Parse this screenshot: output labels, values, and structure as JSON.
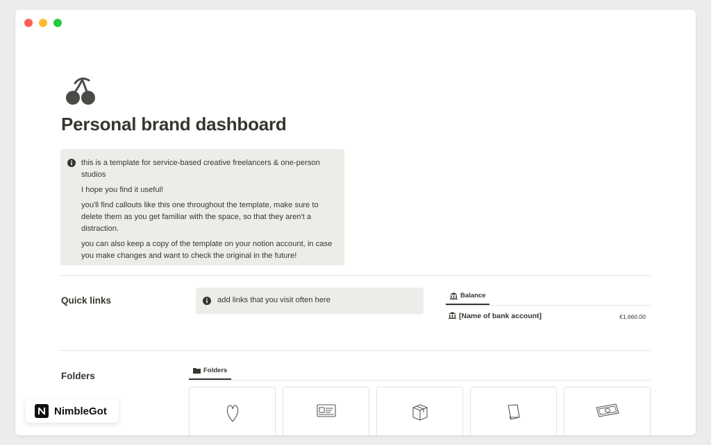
{
  "window": {
    "controls": [
      "close",
      "minimize",
      "maximize"
    ]
  },
  "page": {
    "icon": "cherry-icon",
    "title": "Personal brand dashboard"
  },
  "intro_callout": {
    "icon": "info-icon",
    "paragraphs": [
      "this is a template for service-based creative freelancers & one-person studios",
      "I hope you find it useful!",
      "you'll find callouts like this one throughout the template, make sure to delete them as you get familiar with the space, so that they aren't a distraction.",
      "you can also keep a copy of the template on your notion account, in case you make changes and want to check the original in the future!"
    ]
  },
  "quick_links": {
    "label": "Quick links",
    "callout_text": "add links that you visit often here"
  },
  "balance": {
    "tab_label": "Balance",
    "row_name": "[Name of bank account]",
    "row_amount": "€1,660.00"
  },
  "folders": {
    "label": "Folders",
    "tab_label": "Folders",
    "cards": [
      {
        "icon": "heart-doodle-icon"
      },
      {
        "icon": "id-card-doodle-icon"
      },
      {
        "icon": "box-doodle-icon"
      },
      {
        "icon": "paper-doodle-icon"
      },
      {
        "icon": "money-doodle-icon"
      }
    ]
  },
  "watermark": {
    "brand": "NimbleGot"
  },
  "colors": {
    "callout_bg": "#ebeee8",
    "text": "#37352f",
    "close": "#fe5f57",
    "minimize": "#febc2e",
    "maximize": "#28c840"
  }
}
